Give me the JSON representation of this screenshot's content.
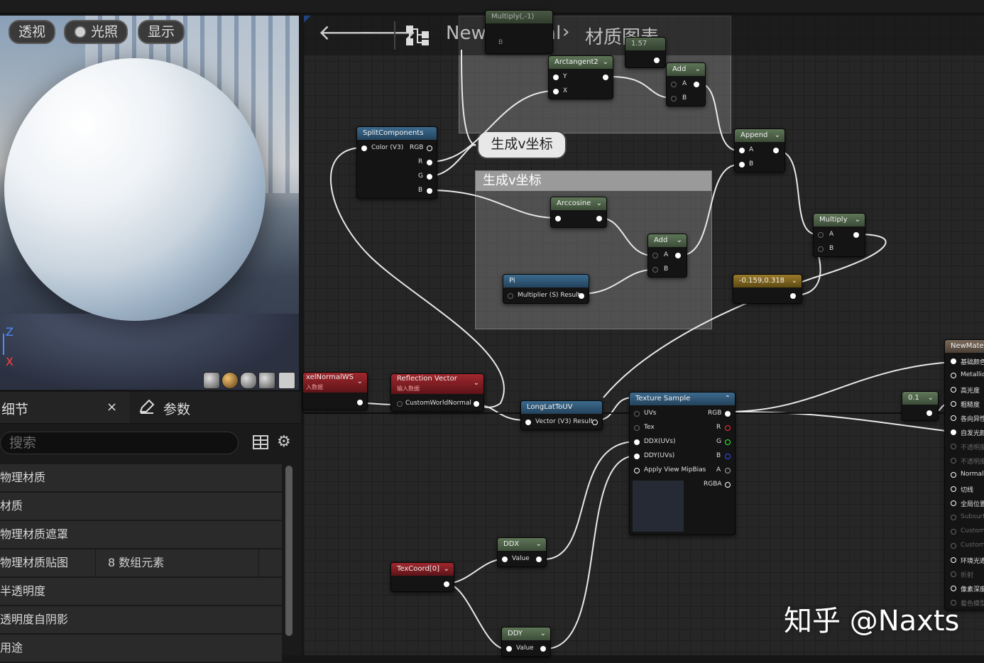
{
  "viewport": {
    "buttons": [
      "透视",
      "光照",
      "显示"
    ],
    "axis_z": "Z",
    "axis_x": "X"
  },
  "details": {
    "tab_details": "细节",
    "tab_close": "×",
    "tab_params": "参数",
    "search_placeholder": "搜索",
    "categories": [
      "物理材质",
      "材质",
      "物理材质遮罩",
      "物理材质贴图",
      "半透明度",
      "透明度自阴影",
      "用途"
    ],
    "phys_map_value": "8 数组元素"
  },
  "graph": {
    "breadcrumb_material": "NewMaterial",
    "breadcrumb_sep": "›",
    "breadcrumb_graph": "材质图表",
    "comment_bubble": "生成v坐标",
    "comment_title": "生成v坐标",
    "nodes": {
      "multiply_top": "Multiply(,-1)",
      "multiply_top_b": "B",
      "const_157": "1.57",
      "arctan": {
        "title": "Arctangent2",
        "y": "Y",
        "x": "X"
      },
      "add1": {
        "title": "Add",
        "a": "A",
        "b": "B"
      },
      "split": {
        "title": "SplitComponents",
        "in": "Color (V3)",
        "rgb": "RGB",
        "r": "R",
        "g": "G",
        "b": "B"
      },
      "append": {
        "title": "Append",
        "a": "A",
        "b": "B"
      },
      "arccos": {
        "title": "Arccosine"
      },
      "add2": {
        "title": "Add",
        "a": "A",
        "b": "B"
      },
      "pi": {
        "title": "Pi",
        "out": "Multiplier (S) Result"
      },
      "multiply": {
        "title": "Multiply",
        "a": "A",
        "b": "B"
      },
      "const_vec": "-0.159,0.318",
      "pixelnormal": {
        "title": "xelNormalWS",
        "sub": "入数据"
      },
      "reflection": {
        "title": "Reflection Vector",
        "sub": "输入数据",
        "in": "CustomWorldNormal"
      },
      "longlat": {
        "title": "LongLatToUV",
        "out": "Vector (V3) Result"
      },
      "texsample": {
        "title": "Texture Sample",
        "uvs": "UVs",
        "tex": "Tex",
        "ddx": "DDX(UVs)",
        "ddy": "DDY(UVs)",
        "mip": "Apply View MipBias",
        "rgb": "RGB",
        "r": "R",
        "g": "G",
        "b": "B",
        "a": "A",
        "rgba": "RGBA"
      },
      "const_01": "0.1",
      "ddx": {
        "title": "DDX",
        "value": "Value"
      },
      "ddy": {
        "title": "DDY",
        "value": "Value"
      },
      "texcoord": {
        "title": "TexCoord[0]"
      },
      "result": {
        "title": "NewMater",
        "pins": [
          "基础颜色",
          "Metallic",
          "高光度",
          "粗糙度",
          "各向异性",
          "自发光颜",
          "不透明度",
          "不透明度",
          "Normal",
          "切线",
          "全局位置",
          "Subsurf",
          "Custom",
          "Custom",
          "环境光遮",
          "折射",
          "像素深度",
          "着色模型"
        ]
      }
    }
  },
  "watermark": "知乎 @Naxts",
  "colors": {
    "bg": "#262626",
    "panel": "#1a1a1a",
    "green_node": "#5f7658",
    "blue_node": "#3c6a8e",
    "red_node": "#a0282e",
    "yellow_node": "#9a7a2a"
  }
}
